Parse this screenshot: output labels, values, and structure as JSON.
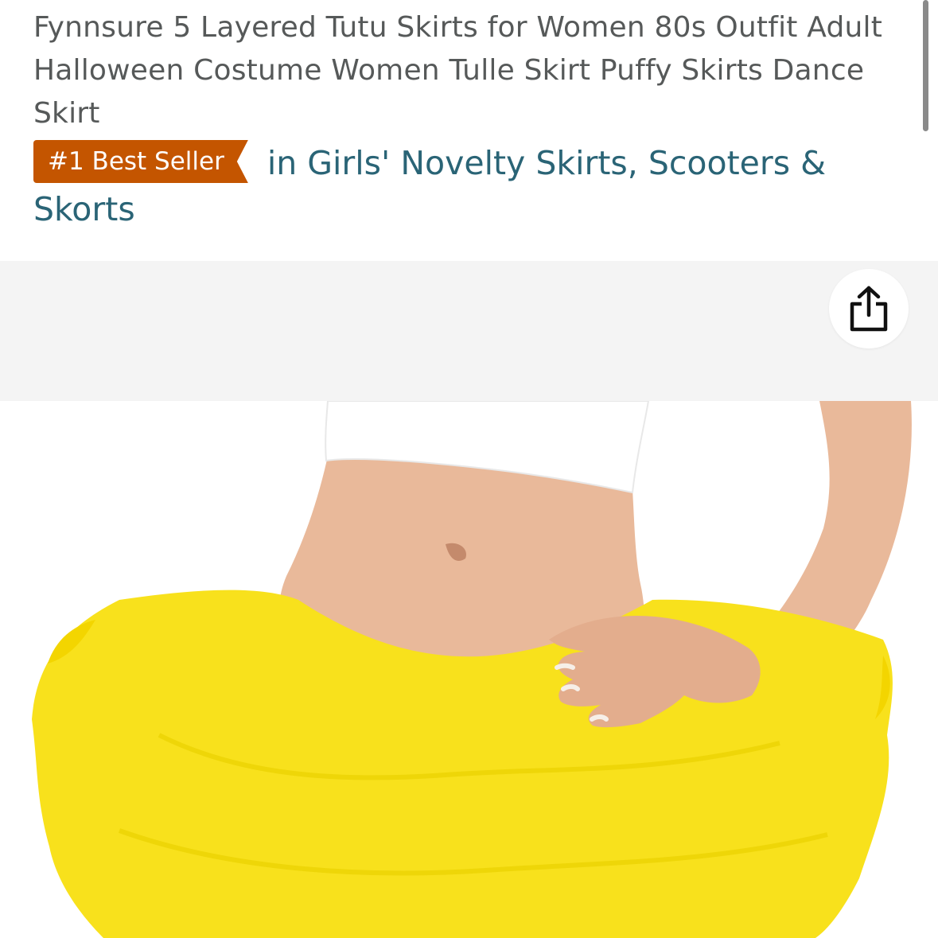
{
  "product": {
    "title": "Fynnsure 5 Layered Tutu Skirts for Women 80s Outfit Adult Halloween Costume Women Tulle Skirt Puffy Skirts Dance Skirt",
    "badge_label": "#1 Best Seller",
    "badge_category": "in Girls' Novelty Skirts, Scooters & Skorts"
  },
  "gallery": {
    "share_icon": "share-icon",
    "image_subject": "yellow-tutu-product-photo"
  },
  "colors": {
    "badge_background": "#c45500",
    "link": "#2a6476",
    "title_text": "#565959",
    "tutu_yellow": "#f8e11c"
  }
}
